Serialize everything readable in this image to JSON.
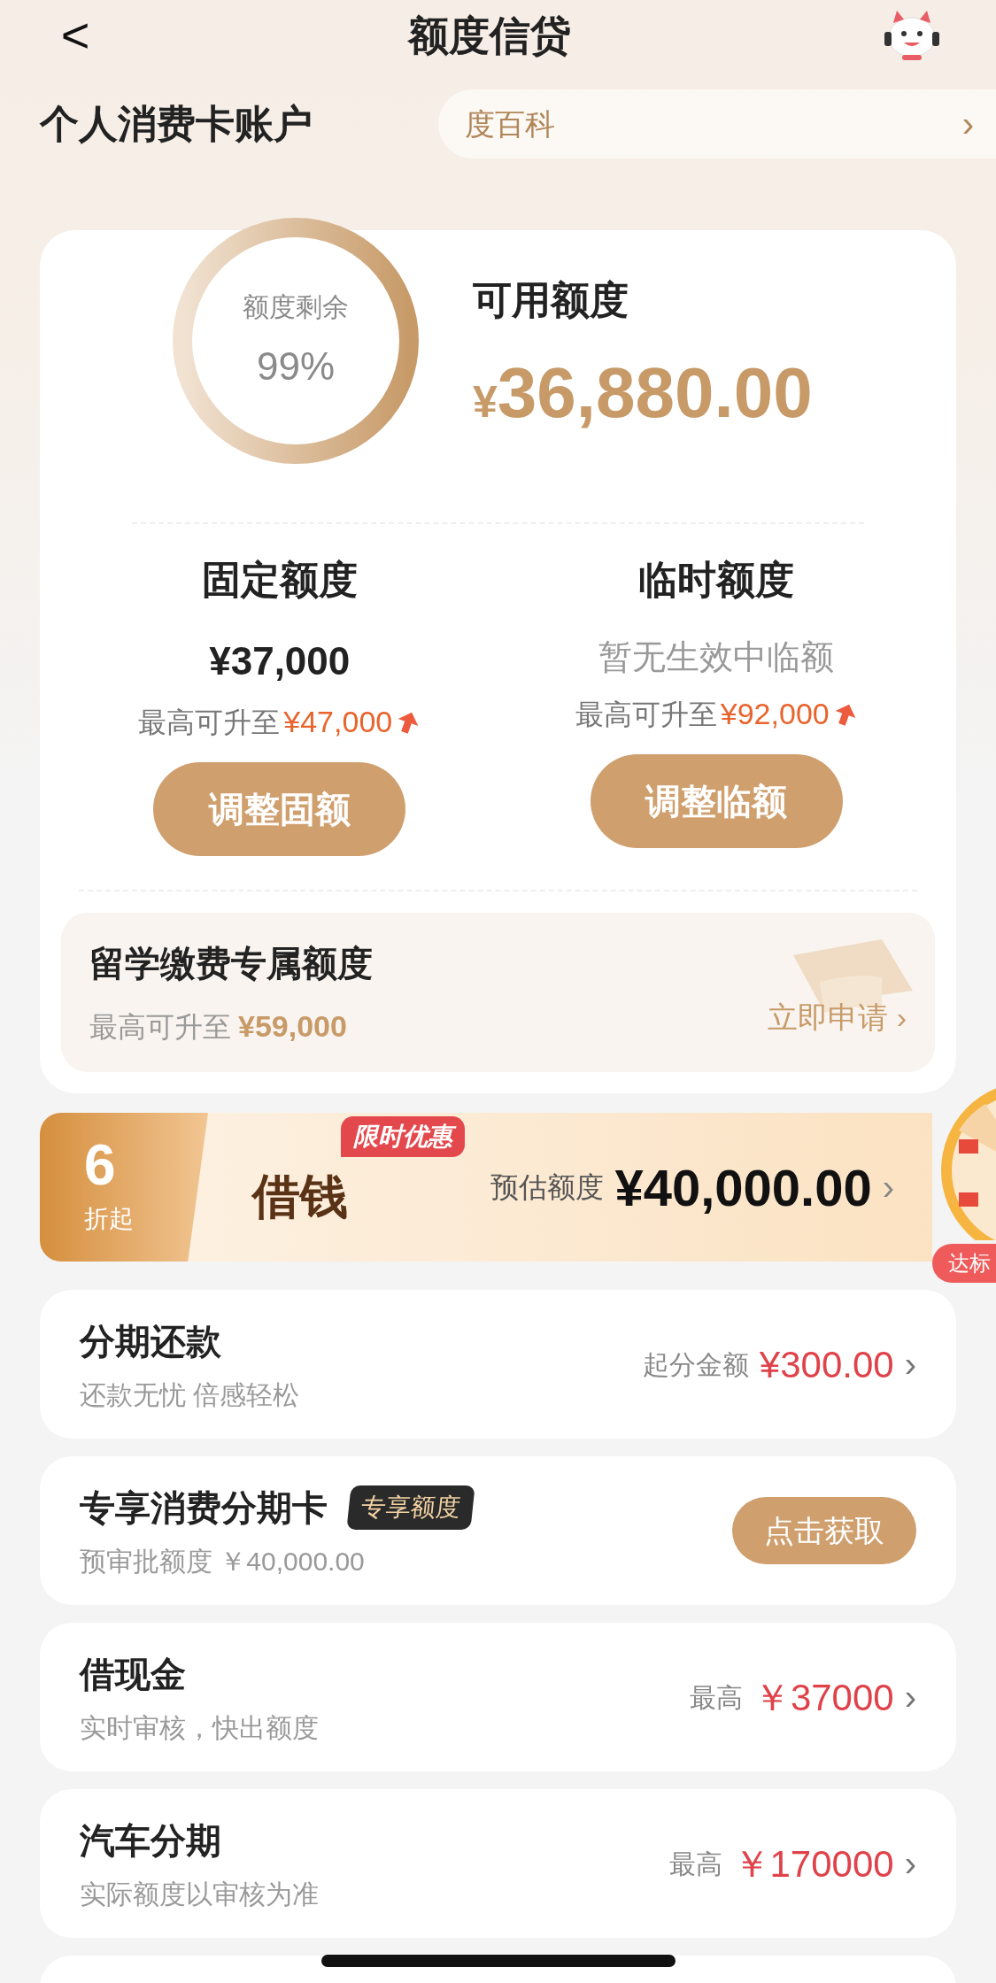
{
  "header": {
    "back": "<",
    "title": "额度信贷"
  },
  "account": {
    "title": "个人消费卡账户",
    "ticker": "度百科",
    "ticker_arrow": "›"
  },
  "summary": {
    "ring_label": "额度剩余",
    "ring_percent": "99%",
    "available_label": "可用额度",
    "currency": "¥",
    "available_amount": "36,880.00"
  },
  "quotas": [
    {
      "title": "固定额度",
      "value": "¥37,000",
      "kind": "amount",
      "upgrade_label": "最高可升至",
      "upgrade_amount": "¥47,000",
      "button": "调整固额"
    },
    {
      "title": "临时额度",
      "value": "暂无生效中临额",
      "kind": "note",
      "upgrade_label": "最高可升至",
      "upgrade_amount": "¥92,000",
      "button": "调整临额"
    }
  ],
  "study": {
    "title": "留学缴费专属额度",
    "label": "最高可升至",
    "amount": "¥59,000",
    "link": "立即申请 ›"
  },
  "banner": {
    "discount": "6",
    "discount_unit": "折起",
    "name": "借钱",
    "tag": "限时优惠",
    "estimate_label": "预估额度",
    "estimate_amount": "¥40,000.00",
    "arrow": "›",
    "badge": "达标"
  },
  "products": [
    {
      "kind": "amount",
      "title": "分期还款",
      "subtitle": "还款无忧 倍感轻松",
      "label": "起分金额",
      "amount": "¥300.00",
      "arrow": "›"
    },
    {
      "kind": "button",
      "title": "专享消费分期卡",
      "tag": "专享额度",
      "subtitle": "预审批额度 ￥40,000.00",
      "button": "点击获取"
    },
    {
      "kind": "amount",
      "title": "借现金",
      "subtitle": "实时审核，快出额度",
      "label": "最高",
      "amount": "￥37000",
      "arrow": "›"
    },
    {
      "kind": "amount",
      "title": "汽车分期",
      "subtitle": "实际额度以审核为准",
      "label": "最高",
      "amount": "￥170000",
      "arrow": "›"
    }
  ]
}
